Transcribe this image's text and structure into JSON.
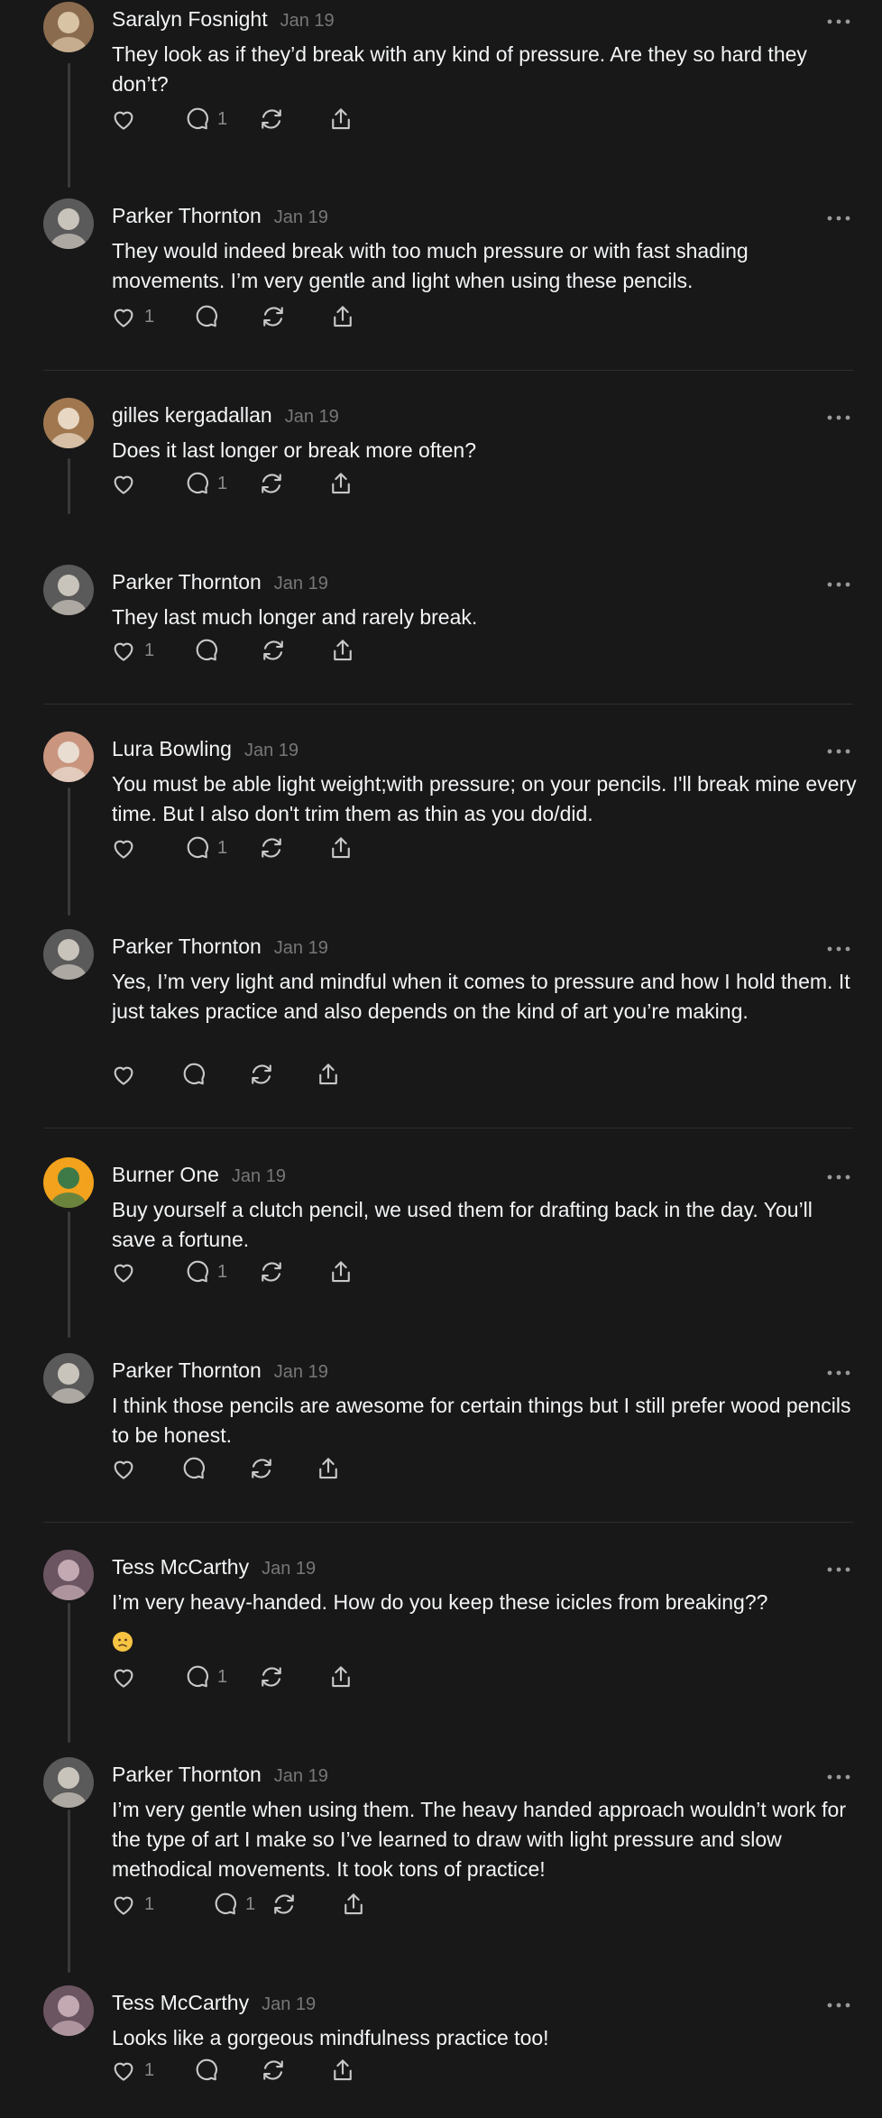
{
  "posts": [
    {
      "author": "Saralyn Fosnight",
      "date": "Jan 19",
      "text": "They look as if they’d break with any kind of pressure. Are they so hard they don’t?",
      "likes": "",
      "replies": "1",
      "avatar": "avatar-saralyn",
      "avatar_colors": [
        "#8a6b4e",
        "#d9c3a5"
      ]
    },
    {
      "author": "Parker Thornton",
      "date": "Jan 19",
      "text": "They would indeed break with too much pressure or with fast shading movements. I’m very gentle and light when using these pencils.",
      "likes": "1",
      "replies": "",
      "avatar": "avatar-parker",
      "avatar_colors": [
        "#5a5a5a",
        "#c9c4bb"
      ]
    },
    {
      "author": "gilles kergadallan",
      "date": "Jan 19",
      "text": "Does it last longer or break more often?",
      "likes": "",
      "replies": "1",
      "avatar": "avatar-gilles",
      "avatar_colors": [
        "#a0774f",
        "#e8d7c2"
      ]
    },
    {
      "author": "Parker Thornton",
      "date": "Jan 19",
      "text": "They last much longer and rarely break.",
      "likes": "1",
      "replies": "",
      "avatar": "avatar-parker",
      "avatar_colors": [
        "#5a5a5a",
        "#c9c4bb"
      ]
    },
    {
      "author": "Lura Bowling",
      "date": "Jan 19",
      "text": "You must be able light weight;with pressure; on your pencils. I'll break mine every time. But I also don't trim them as thin as you do/did.",
      "likes": "",
      "replies": "1",
      "avatar": "avatar-lura",
      "avatar_colors": [
        "#c9957e",
        "#e9ddd2"
      ]
    },
    {
      "author": "Parker Thornton",
      "date": "Jan 19",
      "text": "Yes, I’m very light and mindful when it comes to pressure and how I hold them. It just takes practice and also depends on the kind of art you’re making.",
      "likes": "",
      "replies": "",
      "avatar": "avatar-parker",
      "avatar_colors": [
        "#5a5a5a",
        "#c9c4bb"
      ]
    },
    {
      "author": "Burner One",
      "date": "Jan 19",
      "text": "Buy yourself a clutch pencil, we used them for drafting back in the day. You’ll save a fortune.",
      "likes": "",
      "replies": "1",
      "avatar": "avatar-burner",
      "avatar_colors": [
        "#f2a21c",
        "#3d7a48"
      ]
    },
    {
      "author": "Parker Thornton",
      "date": "Jan 19",
      "text": "I think those pencils are awesome for certain things but I still prefer wood pencils to be honest.",
      "likes": "",
      "replies": "",
      "avatar": "avatar-parker",
      "avatar_colors": [
        "#5a5a5a",
        "#c9c4bb"
      ]
    },
    {
      "author": "Tess McCarthy",
      "date": "Jan 19",
      "text": "I’m very heavy-handed. How do you keep these icicles from breaking??",
      "likes": "",
      "replies": "1",
      "avatar": "avatar-tess",
      "avatar_colors": [
        "#6b5561",
        "#c3a9b2"
      ],
      "emoji": "confused-face-emoji"
    },
    {
      "author": "Parker Thornton",
      "date": "Jan 19",
      "text": "I’m very gentle when using them. The heavy handed approach wouldn’t work for the type of art I make so I’ve learned to draw with light pressure and slow methodical movements. It took tons of practice!",
      "likes": "1",
      "replies": "1",
      "avatar": "avatar-parker",
      "avatar_colors": [
        "#5a5a5a",
        "#c9c4bb"
      ]
    },
    {
      "author": "Tess McCarthy",
      "date": "Jan 19",
      "text": "Looks like a gorgeous mindfulness practice too!",
      "likes": "1",
      "replies": "",
      "avatar": "avatar-tess",
      "avatar_colors": [
        "#6b5561",
        "#c3a9b2"
      ]
    }
  ],
  "icons": {
    "like": "heart-icon",
    "reply": "comment-icon",
    "repost": "repost-icon",
    "share": "share-icon",
    "more": "more-options-icon"
  },
  "colors": {
    "background": "#181818",
    "text": "#f3f5f7",
    "muted": "#777777",
    "icon": "#bdbdbd",
    "divider": "#2d2d2d",
    "thread_line": "#3a3a3a"
  }
}
